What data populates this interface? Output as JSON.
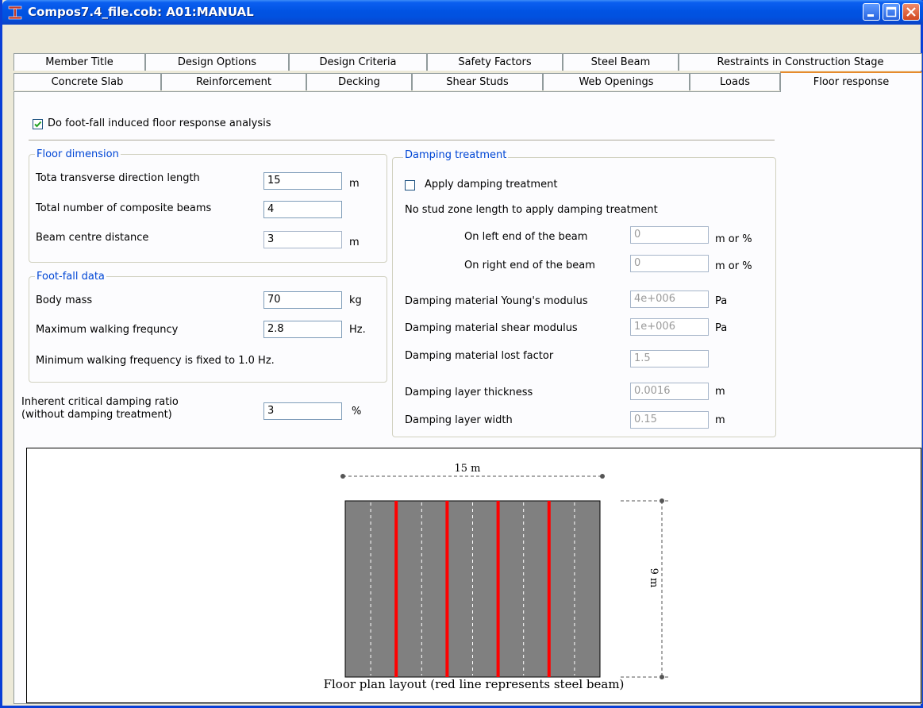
{
  "window": {
    "title": "Compos7.4_file.cob: A01:MANUAL",
    "icon": "i-beam-icon",
    "buttons": [
      "minimize",
      "maximize",
      "close"
    ]
  },
  "tabs": {
    "row1": [
      "Member Title",
      "Design Options",
      "Design Criteria",
      "Safety Factors",
      "Steel Beam",
      "Restraints in Construction Stage"
    ],
    "row2": [
      "Concrete Slab",
      "Reinforcement",
      "Decking",
      "Shear Studs",
      "Web Openings",
      "Loads",
      "Floor response"
    ],
    "active": "Floor response"
  },
  "footfall_checkbox": {
    "label": "Do foot-fall induced floor response analysis",
    "checked": true
  },
  "floor_dimension": {
    "title": "Floor dimension",
    "transverse_label": "Tota transverse direction length",
    "transverse_value": "15",
    "transverse_unit": "m",
    "beams_label": "Total number of composite beams",
    "beams_value": "4",
    "spacing_label": "Beam centre distance",
    "spacing_value": "3",
    "spacing_unit": "m"
  },
  "footfall_data": {
    "title": "Foot-fall data",
    "mass_label": "Body mass",
    "mass_value": "70",
    "mass_unit": "kg",
    "freq_label": "Maximum walking frequncy",
    "freq_value": "2.8",
    "freq_unit": "Hz.",
    "note": "Minimum walking frequency is fixed to 1.0  Hz."
  },
  "damping_ratio": {
    "label_line1": "Inherent critical damping ratio",
    "label_line2": " (without damping treatment)",
    "value": "3",
    "unit": "%"
  },
  "damping_treatment": {
    "title": "Damping treatment",
    "apply_label": "Apply damping treatment",
    "apply_checked": false,
    "nostud_label": "No stud zone length to apply damping treatment",
    "left_label": "On left end of the beam",
    "left_value": "0",
    "left_unit": "m or %",
    "right_label": "On right end of the beam",
    "right_value": "0",
    "right_unit": "m or %",
    "young_label": "Damping material Young's modulus",
    "young_value": "4e+006",
    "young_unit": "Pa",
    "shear_label": "Damping material shear modulus",
    "shear_value": "1e+006",
    "shear_unit": "Pa",
    "loss_label": "Damping material lost factor",
    "loss_value": "1.5",
    "thick_label": "Damping layer thickness",
    "thick_value": "0.0016",
    "thick_unit": "m",
    "width_label": "Damping layer width",
    "width_value": "0.15",
    "width_unit": "m"
  },
  "floor_plan": {
    "width_label": "15 m",
    "height_label": "9 m",
    "caption": "Floor plan layout (red line represents steel beam)",
    "beam_count": 4,
    "colors": {
      "slab": "#808080",
      "beam": "#ff0000",
      "grid": "#ffffff"
    }
  }
}
